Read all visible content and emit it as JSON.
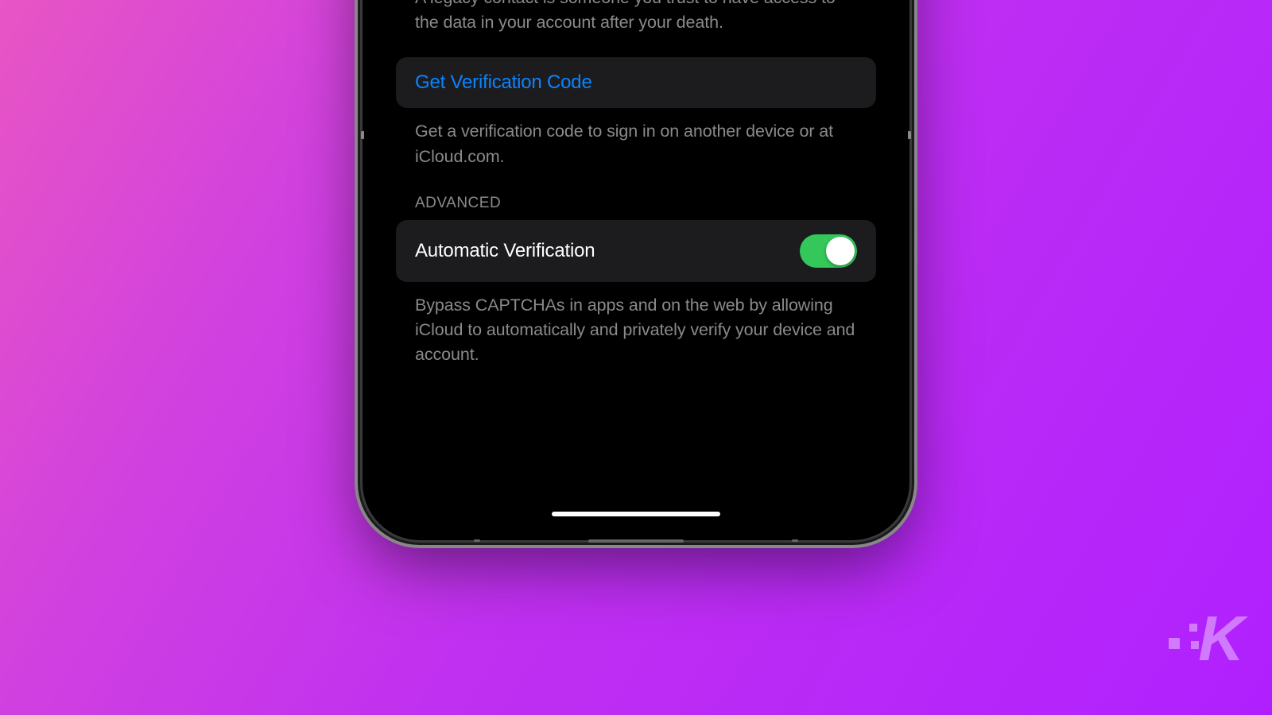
{
  "legacy_contact": {
    "footer_text": "A legacy contact is someone you trust to have access to the data in your account after your death."
  },
  "verification": {
    "button_label": "Get Verification Code",
    "footer_text": "Get a verification code to sign in on another device or at iCloud.com."
  },
  "advanced": {
    "header": "ADVANCED",
    "automatic_verification": {
      "label": "Automatic Verification",
      "enabled": true
    },
    "footer_text": "Bypass CAPTCHAs in apps and on the web by allowing iCloud to automatically and privately verify your device and account."
  },
  "watermark": "K"
}
